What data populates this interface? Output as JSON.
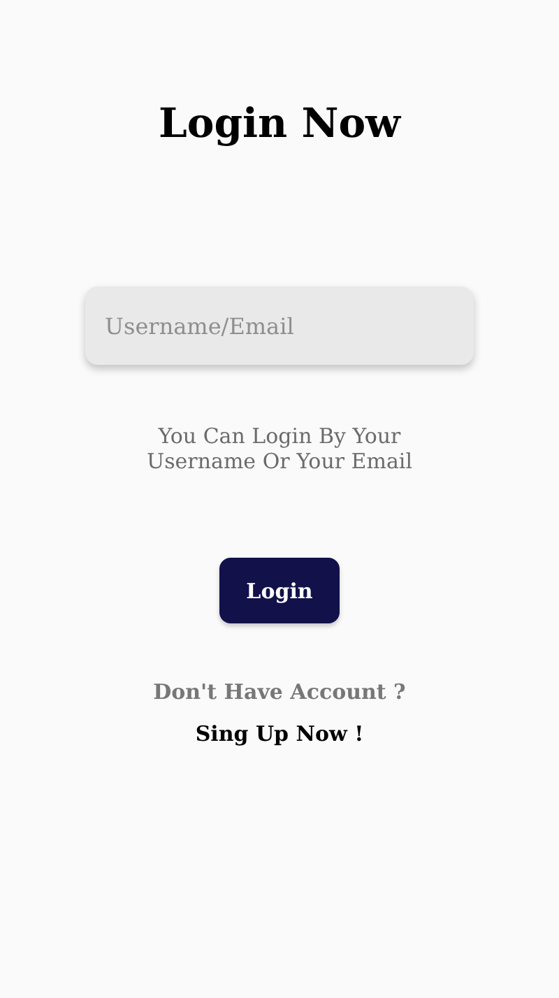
{
  "title": "Login Now",
  "username_field": {
    "placeholder": "Username/Email"
  },
  "hint": "You Can Login By Your Username Or Your Email",
  "login_button": "Login",
  "signup_prompt": "Don't Have Account ?",
  "signup_link": "Sing Up Now !"
}
